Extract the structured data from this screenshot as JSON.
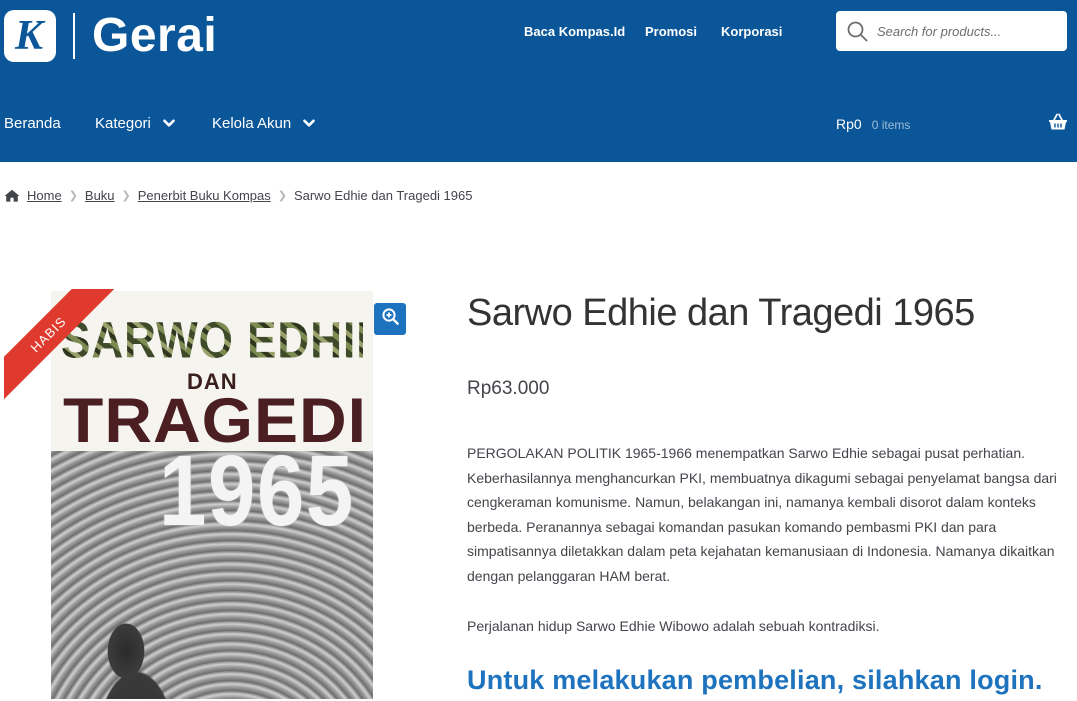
{
  "brand": {
    "logo_letter": "K",
    "name": "Gerai",
    "primary_color": "#0a5699"
  },
  "topnav": {
    "items": [
      {
        "label": "Baca Kompas.Id"
      },
      {
        "label": "Promosi"
      },
      {
        "label": "Korporasi"
      }
    ]
  },
  "search": {
    "placeholder": "Search for products...",
    "value": "",
    "icon": "search-icon"
  },
  "mainnav": {
    "items": [
      {
        "label": "Beranda",
        "has_dropdown": false
      },
      {
        "label": "Kategori",
        "has_dropdown": true
      },
      {
        "label": "Kelola Akun",
        "has_dropdown": true
      }
    ]
  },
  "cart": {
    "amount": "Rp0",
    "count": "0 items",
    "icon": "basket-icon"
  },
  "breadcrumb": {
    "items": [
      {
        "label": "Home",
        "link": true
      },
      {
        "label": "Buku",
        "link": true
      },
      {
        "label": "Penerbit Buku Kompas",
        "link": true
      },
      {
        "label": "Sarwo Edhie dan Tragedi 1965",
        "link": false
      }
    ]
  },
  "product": {
    "badge": "HABIS",
    "badge_color": "#e03a2f",
    "cover": {
      "line1": "SARWO EDHIE",
      "line2": "DAN",
      "line3": "TRAGEDI",
      "line4": "1965"
    },
    "title": "Sarwo Edhie dan Tragedi 1965",
    "price": "Rp63.000",
    "description": "PERGOLAKAN POLITIK 1965-1966 menempatkan Sarwo Edhie sebagai pusat perhatian. Keberhasilannya menghancurkan PKI, membuatnya dikagumi sebagai penyelamat bangsa dari cengkeraman komunisme. Namun, belakangan ini, namanya kembali disorot dalam konteks berbeda. Peranannya sebagai komandan pasukan komando pembasmi PKI dan para simpatisannya diletakkan dalam peta kejahatan kemanusiaan di Indonesia. Namanya dikaitkan dengan pelanggaran HAM berat.",
    "description2": "Perjalanan hidup Sarwo Edhie Wibowo adalah sebuah kontradiksi.",
    "login_message": "Untuk melakukan pembelian, silahkan login.",
    "accent_color": "#1e73be"
  }
}
